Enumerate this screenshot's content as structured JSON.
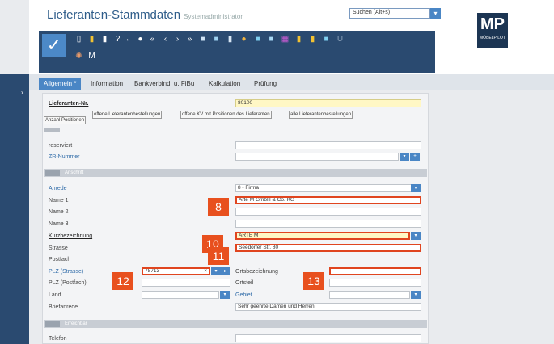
{
  "header": {
    "title": "Lieferanten-Stammdaten",
    "subtitle": "Systemadministrator",
    "search_placeholder": "Suchen (Alt+s)"
  },
  "logo": {
    "mark": "MP",
    "text": "MÖBELPILOT"
  },
  "toolbar": {
    "confirm": "✓",
    "extra_label": "M"
  },
  "tabs": [
    "Allgemein *",
    "Information",
    "Bankverbind. u. FiBu",
    "Kalkulation",
    "Prüfung"
  ],
  "form": {
    "lieferanten_nr_label": "Lieferanten-Nr.",
    "lieferanten_nr_value": "80100",
    "kv_buttons": [
      "Anzahl Positionen",
      "offene Lieferantenbestellungen",
      "offene KV mit Positionen des Lieferanten",
      "alle Lieferantenbestellungen"
    ],
    "reserviert_label": "reserviert",
    "zr_nummer_label": "ZR-Nummer",
    "section_anschrift": "Anschrift",
    "anrede_label": "Anrede",
    "anrede_value": "8 - Firma",
    "name1_label": "Name 1",
    "name1_value": "Arte M GmbH & Co. KG",
    "name2_label": "Name 2",
    "name3_label": "Name 3",
    "kurzbezeichnung_label": "Kurzbezeichnung",
    "kurzbezeichnung_value": "ARTE M",
    "strasse_label": "Strasse",
    "strasse_value": "Seedorfer Str. 80",
    "postfach_label": "Postfach",
    "plz_strasse_label": "PLZ (Strasse)",
    "plz_strasse_value": "78713",
    "plz_clear": "×",
    "ortsbezeichnung_label": "Ortsbezeichnung",
    "plz_postfach_label": "PLZ (Postfach)",
    "ortsteil_label": "Ortsteil",
    "land_label": "Land",
    "gebiet_label": "Gebiet",
    "briefanrede_label": "Briefanrede",
    "briefanrede_value": "Sehr geehrte Damen und Herren,",
    "section_erreichbar": "Erreichbar",
    "telefon_label": "Telefon"
  },
  "badges": [
    "8",
    "10",
    "11",
    "12",
    "13"
  ]
}
